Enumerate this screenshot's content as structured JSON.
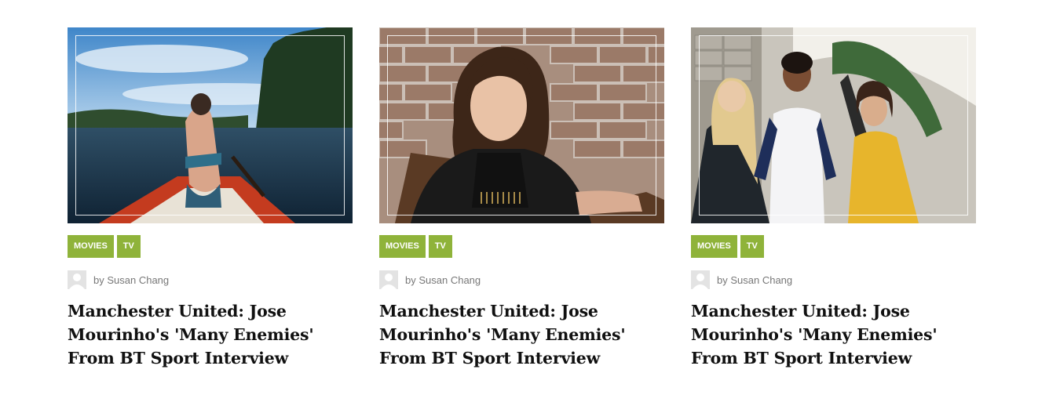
{
  "colors": {
    "tag_bg": "#8fb33a"
  },
  "posts": [
    {
      "image_alt": "woman paddling a canoe on a lake",
      "tags": [
        "MOVIES",
        "TV"
      ],
      "by": "by",
      "author": "Susan Chang",
      "title": "Manchester United: Jose Mourinho's 'Many Enemies' From BT Sport Interview"
    },
    {
      "image_alt": "woman sitting in front of brick wall",
      "tags": [
        "MOVIES",
        "TV"
      ],
      "by": "by",
      "author": "Susan Chang",
      "title": "Manchester United: Jose Mourinho's 'Many Enemies' From BT Sport Interview"
    },
    {
      "image_alt": "three friends talking outdoors",
      "tags": [
        "MOVIES",
        "TV"
      ],
      "by": "by",
      "author": "Susan Chang",
      "title": "Manchester United: Jose Mourinho's 'Many Enemies' From BT Sport Interview"
    }
  ]
}
